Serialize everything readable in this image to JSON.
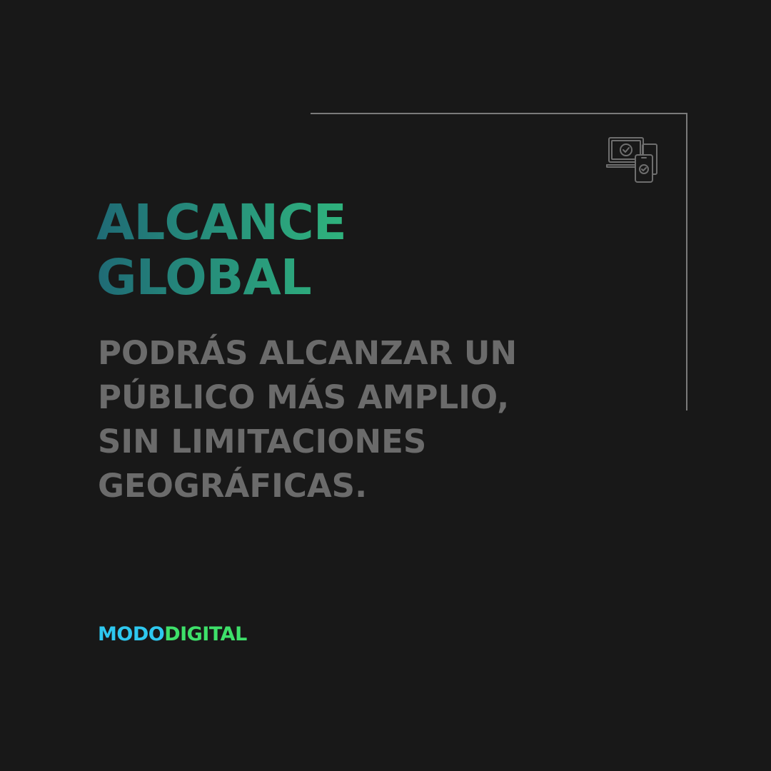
{
  "headline": {
    "line1": "ALCANCE",
    "line2": "GLOBAL"
  },
  "body": {
    "lines": [
      "PODRÁS ALCANZAR UN",
      "PÚBLICO MÁS AMPLIO,",
      "SIN LIMITACIONES",
      "GEOGRÁFICAS."
    ]
  },
  "brand": {
    "part1": "MODO",
    "part2": "DIGITAL"
  },
  "icon": "devices-check-icon",
  "colors": {
    "background": "#181818",
    "headline_gradient_start": "#1f6a75",
    "headline_gradient_end": "#2fb37d",
    "body_text": "#6b6b6b",
    "frame_line": "#7a7a7a",
    "brand_part1": "#2ec8ef",
    "brand_part2": "#3ee06a"
  }
}
